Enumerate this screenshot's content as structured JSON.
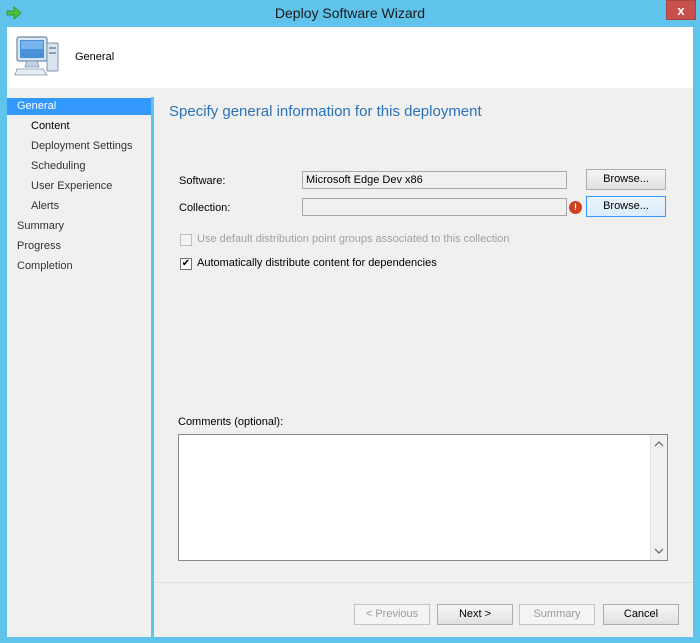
{
  "window": {
    "title": "Deploy Software Wizard",
    "close_label": "x"
  },
  "header": {
    "title": "General"
  },
  "nav": {
    "items": [
      {
        "label": "General",
        "selected": true
      },
      {
        "label": "Content"
      },
      {
        "label": "Deployment Settings"
      },
      {
        "label": "Scheduling"
      },
      {
        "label": "User Experience"
      },
      {
        "label": "Alerts"
      },
      {
        "label": "Summary"
      },
      {
        "label": "Progress"
      },
      {
        "label": "Completion"
      }
    ]
  },
  "main": {
    "heading": "Specify general information for this deployment",
    "software_label": "Software:",
    "software_value": "Microsoft Edge Dev x86",
    "collection_label": "Collection:",
    "collection_value": "",
    "browse_label": "Browse...",
    "error_glyph": "!",
    "use_default_dp_label": "Use default distribution point groups associated to this collection",
    "use_default_dp_checked": false,
    "auto_distribute_label": "Automatically distribute content for dependencies",
    "auto_distribute_checked": true,
    "check_glyph": "✔",
    "comments_label": "Comments (optional):",
    "comments_value": ""
  },
  "footer": {
    "previous_label": "< Previous",
    "next_label": "Next >",
    "summary_label": "Summary",
    "cancel_label": "Cancel"
  },
  "colors": {
    "titlebar": "#5fc3ec",
    "accent": "#3399ff",
    "heading": "#2b72b8",
    "close": "#c7504b"
  }
}
